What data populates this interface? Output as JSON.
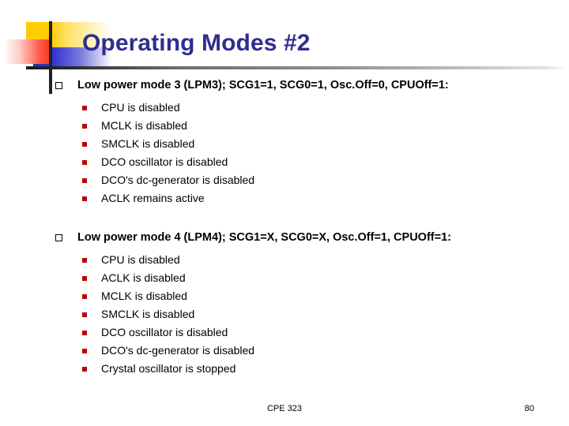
{
  "slide": {
    "title": "Operating Modes #2",
    "accent_colors": {
      "title": "#2E2E8F",
      "yellow": "#FFCC00",
      "blue": "#3333CC",
      "red": "#F23A24",
      "rule": "#1F1F2E",
      "sub_bullet": "#C00000"
    },
    "blocks": [
      {
        "heading": "Low power mode 3 (LPM3); SCG1=1, SCG0=1, Osc.Off=0, CPUOff=1:",
        "items": [
          "CPU is disabled",
          "MCLK is disabled",
          "SMCLK is disabled",
          "DCO oscillator is disabled",
          "DCO's dc-generator is disabled",
          "ACLK remains active"
        ]
      },
      {
        "heading": "Low power mode 4 (LPM4); SCG1=X, SCG0=X, Osc.Off=1, CPUOff=1:",
        "items": [
          "CPU is disabled",
          "ACLK is disabled",
          "MCLK is disabled",
          "SMCLK is disabled",
          "DCO oscillator is disabled",
          "DCO's dc-generator is disabled",
          "Crystal oscillator is stopped"
        ]
      }
    ],
    "footer": {
      "course": "CPE 323",
      "page_number": "80"
    }
  }
}
